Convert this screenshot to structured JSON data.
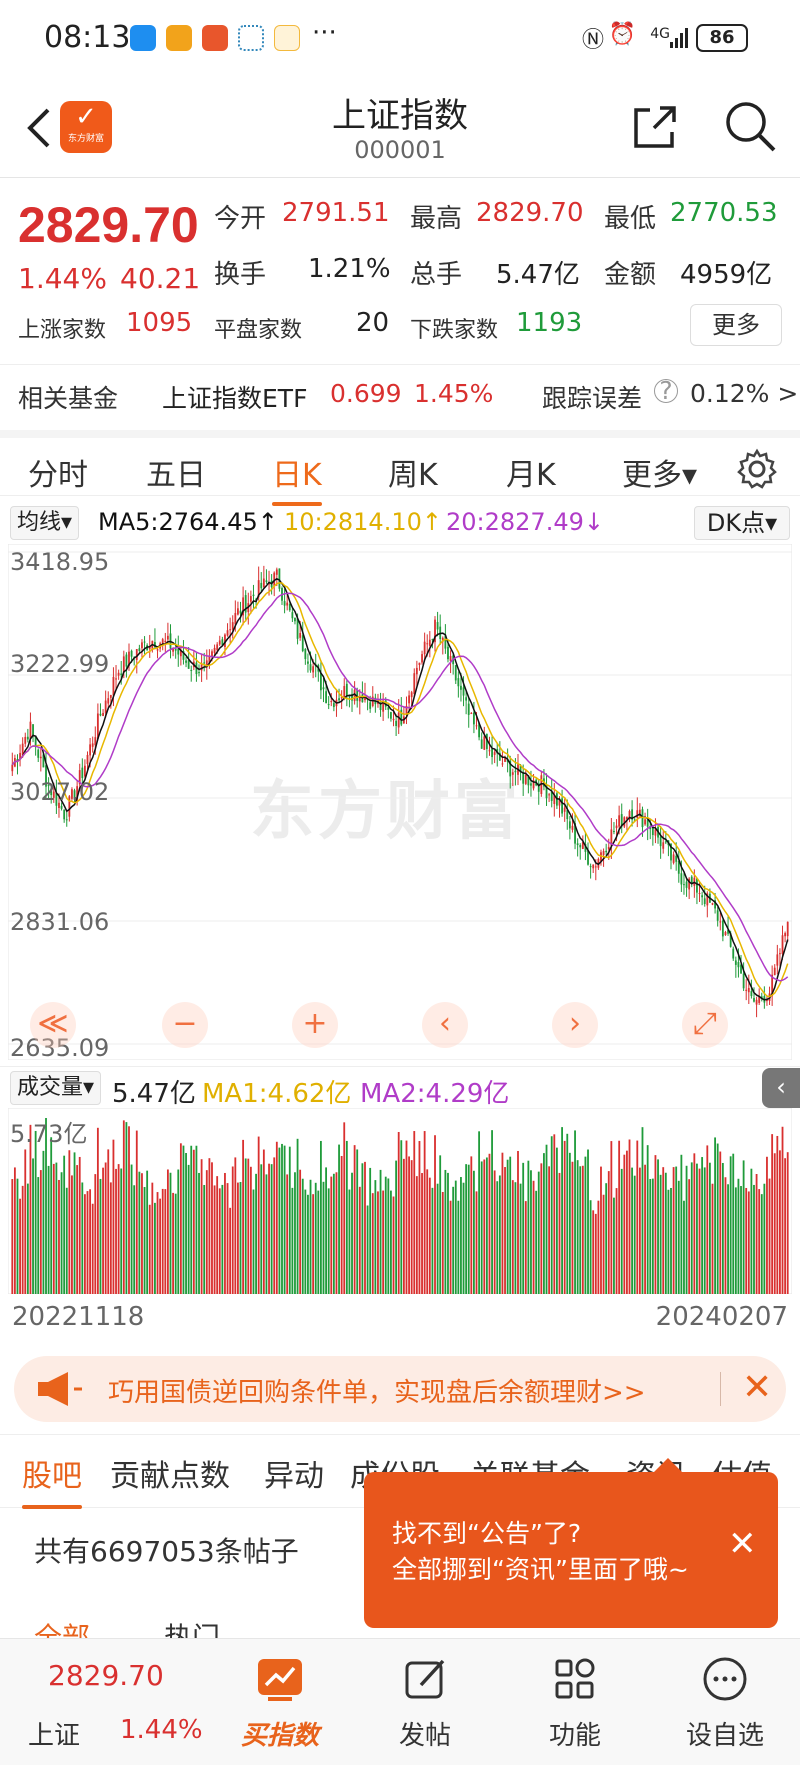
{
  "status_bar": {
    "time": "08:13",
    "more": "···",
    "network": "4G",
    "battery": "86"
  },
  "header": {
    "title": "上证指数",
    "code": "000001",
    "logo_text": "东方财富"
  },
  "quote": {
    "price": "2829.70",
    "change_pct": "1.44%",
    "change": "40.21",
    "open_label": "今开",
    "open": "2791.51",
    "high_label": "最高",
    "high": "2829.70",
    "low_label": "最低",
    "low": "2770.53",
    "turnover_label": "换手",
    "turnover": "1.21%",
    "volume_label": "总手",
    "volume": "5.47亿",
    "amount_label": "金额",
    "amount": "4959亿",
    "up_label": "上涨家数",
    "up": "1095",
    "flat_label": "平盘家数",
    "flat": "20",
    "down_label": "下跌家数",
    "down": "1193",
    "more_label": "更多"
  },
  "related_fund": {
    "label": "相关基金",
    "name": "上证指数ETF",
    "price": "0.699",
    "pct": "1.45%",
    "tracking_label": "跟踪误差",
    "tracking_value": "0.12% >"
  },
  "period_tabs": [
    "分时",
    "五日",
    "日K",
    "周K",
    "月K",
    "更多▾"
  ],
  "active_period": "日K",
  "ma_row": {
    "select": "均线▾",
    "ma5": "MA5:2764.45↑",
    "ma10": "10:2814.10↑",
    "ma20": "20:2827.49↓",
    "dk": "DK点▾"
  },
  "price_axis": [
    "3418.95",
    "3222.99",
    "3027.02",
    "2831.06",
    "2635.09"
  ],
  "volume_row": {
    "select": "成交量▾",
    "vol": "5.47亿",
    "ma1": "MA1:4.62亿",
    "ma2": "MA2:4.29亿",
    "axis_max": "5.73亿"
  },
  "chart_controls": [
    "≪",
    "−",
    "+",
    "‹",
    "›",
    "⤢"
  ],
  "dates": {
    "start": "20221118",
    "end": "20240207"
  },
  "watermark": "东方财富",
  "colors": {
    "up": "#d9302f",
    "down": "#1f9b3a",
    "accent": "#e8631c",
    "ma5": "#111111",
    "ma10": "#e8b800",
    "ma20": "#b03cc8"
  },
  "banner": {
    "text": "巧用国债逆回购条件单，实现盘后余额理财>>",
    "close": "✕"
  },
  "section_tabs": [
    "股吧",
    "贡献点数",
    "异动",
    "成份股",
    "关联基金",
    "资讯",
    "估值"
  ],
  "active_section": "股吧",
  "posts": {
    "count": "共有6697053条帖子",
    "filter_all": "全部",
    "filter_hot": "热门"
  },
  "tooltip": {
    "line1": "找不到“公告”了?",
    "line2": "全部挪到“资讯”里面了哦~",
    "close": "✕"
  },
  "bottom_nav": {
    "index_price": "2829.70",
    "index_name": "上证",
    "index_pct": "1.44%",
    "buy": "买指数",
    "post": "发帖",
    "func": "功能",
    "watch": "设自选"
  },
  "chart_data": {
    "type": "line",
    "x_range": [
      "20221118",
      "20240207"
    ],
    "y_range": [
      2635.09,
      3418.95
    ],
    "y_ticks": [
      3418.95,
      3222.99,
      3027.02,
      2831.06,
      2635.09
    ],
    "series": [
      {
        "name": "MA5",
        "last": 2764.45
      },
      {
        "name": "MA10",
        "last": 2814.1
      },
      {
        "name": "MA20",
        "last": 2827.49
      }
    ],
    "close_trend": [
      3080,
      3140,
      3050,
      3000,
      3070,
      3160,
      3230,
      3260,
      3280,
      3270,
      3240,
      3230,
      3290,
      3330,
      3360,
      3380,
      3300,
      3240,
      3180,
      3200,
      3190,
      3170,
      3150,
      3240,
      3300,
      3230,
      3150,
      3100,
      3080,
      3060,
      3050,
      3020,
      2960,
      2920,
      2970,
      3010,
      2990,
      2950,
      2900,
      2880,
      2840,
      2770,
      2700,
      2720,
      2829.7
    ],
    "volume_max": "5.73亿",
    "volume_last": "5.47亿"
  }
}
